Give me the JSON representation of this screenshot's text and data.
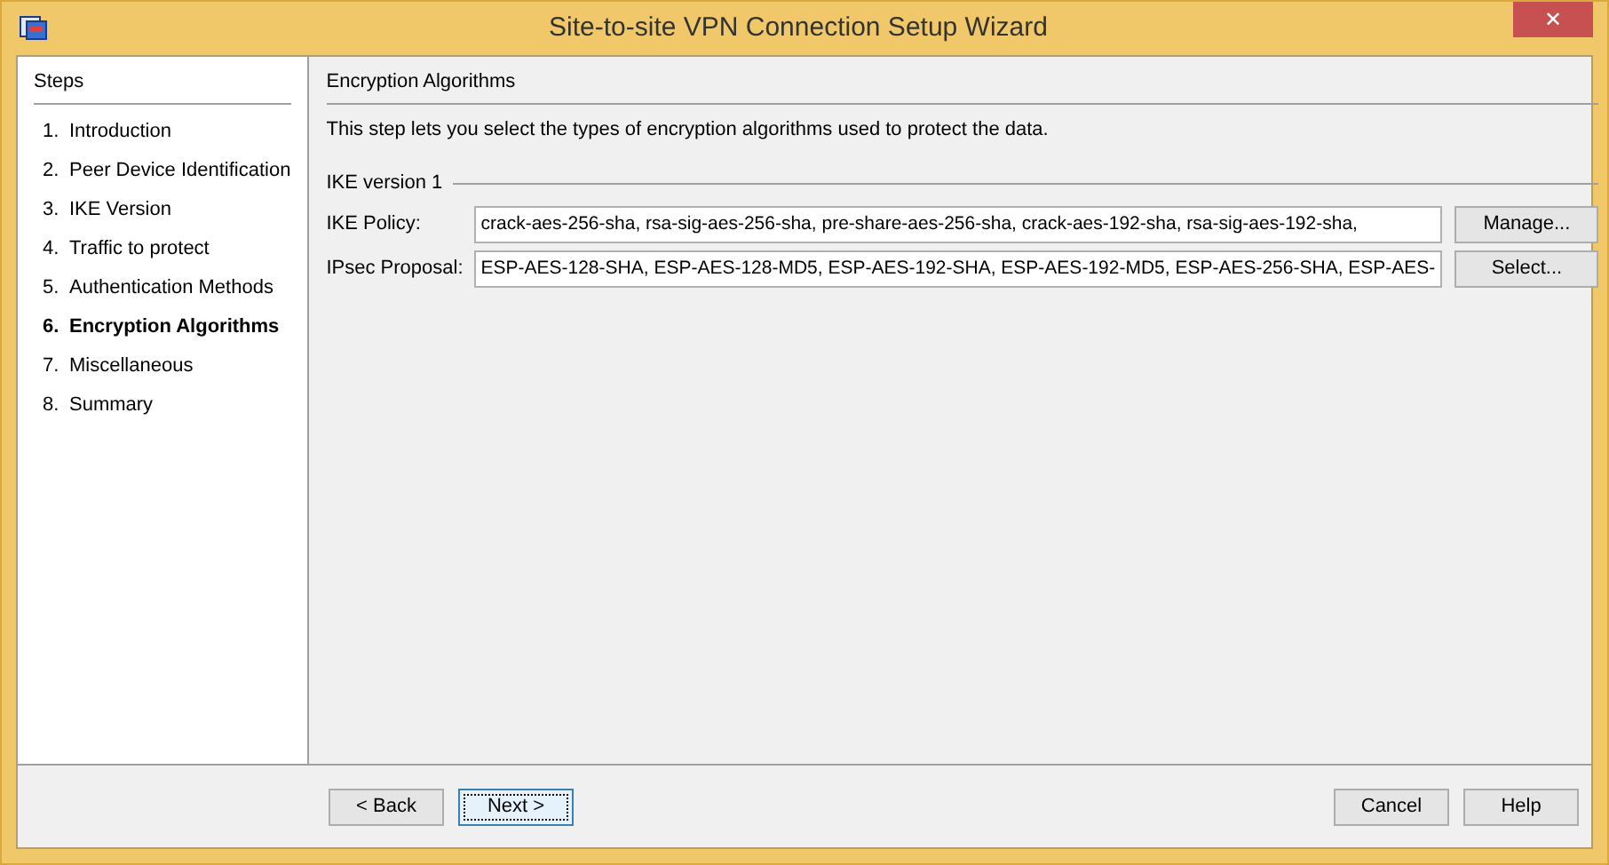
{
  "window": {
    "title": "Site-to-site VPN Connection Setup Wizard",
    "close": "✕"
  },
  "steps": {
    "title": "Steps",
    "items": [
      {
        "number": "1.",
        "label": "Introduction",
        "selected": false
      },
      {
        "number": "2.",
        "label": "Peer Device Identification",
        "selected": false
      },
      {
        "number": "3.",
        "label": "IKE Version",
        "selected": false
      },
      {
        "number": "4.",
        "label": "Traffic to protect",
        "selected": false
      },
      {
        "number": "5.",
        "label": "Authentication Methods",
        "selected": false
      },
      {
        "number": "6.",
        "label": "Encryption Algorithms",
        "selected": true
      },
      {
        "number": "7.",
        "label": "Miscellaneous",
        "selected": false
      },
      {
        "number": "8.",
        "label": "Summary",
        "selected": false
      }
    ]
  },
  "content": {
    "title": "Encryption Algorithms",
    "description": "This step lets you select the types of encryption algorithms used to protect the data.",
    "group": "IKE version 1",
    "fields": [
      {
        "label": "IKE Policy:",
        "value": "crack-aes-256-sha, rsa-sig-aes-256-sha, pre-share-aes-256-sha, crack-aes-192-sha, rsa-sig-aes-192-sha,",
        "button": "Manage..."
      },
      {
        "label": "IPsec Proposal:",
        "value": "ESP-AES-128-SHA, ESP-AES-128-MD5, ESP-AES-192-SHA, ESP-AES-192-MD5, ESP-AES-256-SHA, ESP-AES-",
        "button": "Select..."
      }
    ]
  },
  "footer": {
    "left": [
      {
        "label": "< Back",
        "focused": false
      },
      {
        "label": "Next >",
        "focused": true
      }
    ],
    "right": [
      {
        "label": "Cancel",
        "focused": false
      },
      {
        "label": "Help",
        "focused": false
      }
    ]
  }
}
